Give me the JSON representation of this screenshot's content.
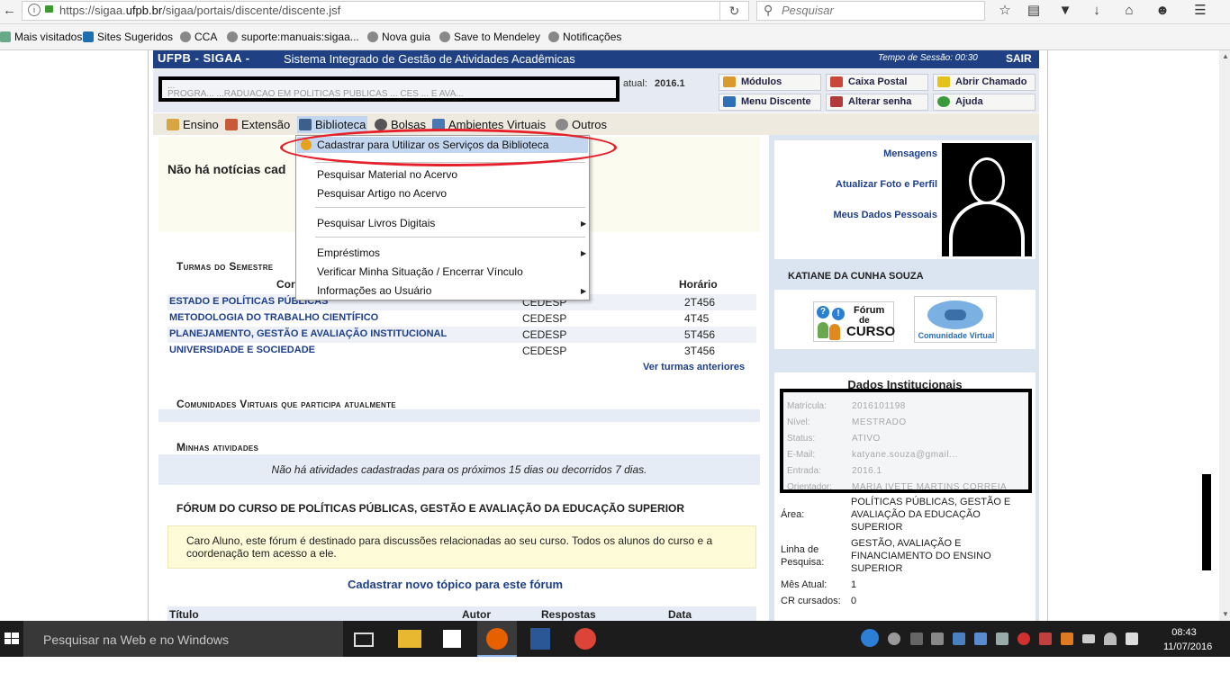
{
  "browser": {
    "url_prefix": "https://sigaa.",
    "url_domain": "ufpb.br",
    "url_path": "/sigaa/portais/discente/discente.jsf",
    "search_placeholder": "Pesquisar",
    "bookmarks": [
      "Mais visitados",
      "Sites Sugeridos",
      "CCA",
      "suporte:manuais:sigaa...",
      "Nova guia",
      "Save to Mendeley",
      "Notificações"
    ]
  },
  "header": {
    "brand": "UFPB - SIGAA -",
    "system_name": "Sistema Integrado de Gestão de Atividades Acadêmicas",
    "session_label": "Tempo de Sessão: 00:30",
    "logout": "SAIR",
    "semester_label": "atual:",
    "semester_value": "2016.1",
    "redacted_line1": "...",
    "redacted_line2": "PROGRA... ...RADUACAO EM POLITICAS PUBLICAS ... CES ... E AVA..."
  },
  "quick_buttons": [
    "Módulos",
    "Caixa Postal",
    "Abrir Chamado",
    "Menu Discente",
    "Alterar senha",
    "Ajuda"
  ],
  "menu": [
    "Ensino",
    "Extensão",
    "Biblioteca",
    "Bolsas",
    "Ambientes Virtuais",
    "Outros"
  ],
  "dropdown": {
    "items": [
      "Cadastrar para Utilizar os Serviços da Biblioteca",
      "Pesquisar Material no Acervo",
      "Pesquisar Artigo no Acervo",
      "Pesquisar Livros Digitais",
      "Empréstimos",
      "Verificar Minha Situação / Encerrar Vínculo",
      "Informações ao Usuário"
    ]
  },
  "news": {
    "text": "Não há notícias cad"
  },
  "turmas": {
    "title": "Turmas do Semestre",
    "col_component": "Cor",
    "col_horario": "Horário",
    "rows": [
      {
        "name": "ESTADO E POLÍTICAS PÚBLICAS",
        "local": "CEDESP",
        "horario": "2T456"
      },
      {
        "name": "METODOLOGIA DO TRABALHO CIENTÍFICO",
        "local": "CEDESP",
        "horario": "4T45"
      },
      {
        "name": "PLANEJAMENTO, GESTÃO E AVALIAÇÃO INSTITUCIONAL",
        "local": "CEDESP",
        "horario": "5T456"
      },
      {
        "name": "UNIVERSIDADE E SOCIEDADE",
        "local": "CEDESP",
        "horario": "3T456"
      }
    ],
    "ver_anteriores": "Ver turmas anteriores"
  },
  "comunidades": {
    "title": "Comunidades Virtuais que participa atualmente"
  },
  "atividades": {
    "title": "Minhas atividades",
    "empty": "Não há atividades cadastradas para os próximos 15 dias ou decorridos 7 dias."
  },
  "forum": {
    "title": "FÓRUM DO CURSO DE POLÍTICAS PÚBLICAS, GESTÃO E AVALIAÇÃO DA EDUCAÇÃO SUPERIOR",
    "note": "Caro Aluno, este fórum é destinado para discussões relacionadas ao seu curso. Todos os alunos do curso e a coordenação tem acesso a ele.",
    "new_topic": "Cadastrar novo tópico para este fórum",
    "columns": [
      "Título",
      "Autor",
      "Respostas",
      "Data"
    ]
  },
  "profile": {
    "links": [
      "Mensagens",
      "Atualizar Foto e Perfil",
      "Meus Dados Pessoais"
    ],
    "name": "KATIANE DA CUNHA SOUZA",
    "forum_icon": {
      "line1": "Fórum",
      "line2": "de",
      "line3": "CURSO"
    },
    "comunidade_label": "Comunidade Virtual"
  },
  "dados": {
    "title": "Dados Institucionais",
    "redacted": [
      {
        "label": "Matrícula:",
        "value": "2016101198"
      },
      {
        "label": "Nível:",
        "value": "MESTRADO"
      },
      {
        "label": "Status:",
        "value": "ATIVO"
      },
      {
        "label": "E-Mail:",
        "value": "katyane.souza@gmail..."
      },
      {
        "label": "Entrada:",
        "value": "2016.1"
      },
      {
        "label": "Orientador:",
        "value": "MARIA IVETE MARTINS CORREIA"
      }
    ],
    "area_label": "Área:",
    "area_value": "POLÍTICAS PÚBLICAS, GESTÃO E AVALIAÇÃO DA EDUCAÇÃO SUPERIOR",
    "linha_label": "Linha de Pesquisa:",
    "linha_value": "GESTÃO, AVALIAÇÃO E FINANCIAMENTO DO ENSINO SUPERIOR",
    "mes_label": "Mês Atual:",
    "mes_value": "1",
    "cr_label": "CR cursados:",
    "cr_value": "0"
  },
  "taskbar": {
    "search_placeholder": "Pesquisar na Web e no Windows",
    "time": "08:43",
    "date": "11/07/2016"
  }
}
